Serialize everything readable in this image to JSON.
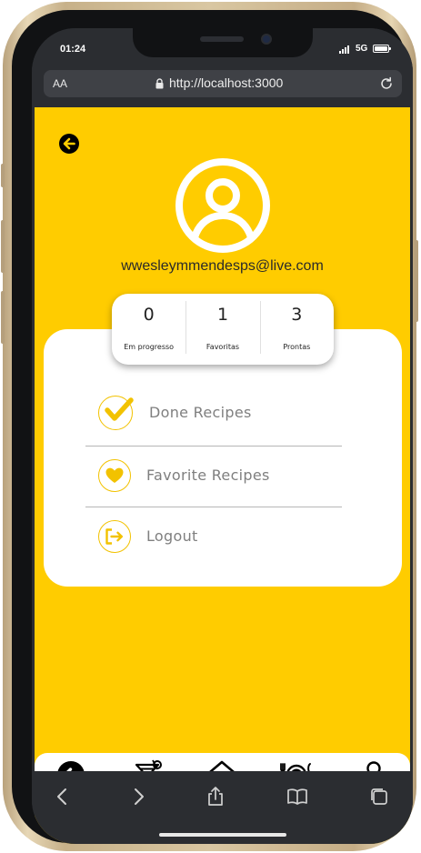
{
  "status_bar": {
    "time": "01:24",
    "network": "5G"
  },
  "browser": {
    "text_size_label": "AA",
    "url": "http://localhost:3000"
  },
  "profile": {
    "email": "wwesleymmendesps@live.com"
  },
  "stats": [
    {
      "value": "0",
      "label": "Em progresso"
    },
    {
      "value": "1",
      "label": "Favoritas"
    },
    {
      "value": "3",
      "label": "Prontas"
    }
  ],
  "menu": {
    "done": "Done Recipes",
    "favorite": "Favorite Recipes",
    "logout": "Logout"
  },
  "colors": {
    "brand_yellow": "#ffcc00",
    "icon_yellow": "#f2c200",
    "menu_text": "#7f7f7f"
  },
  "icons": {
    "back": "arrow-left-circle-icon",
    "avatar": "user-circle-icon",
    "done": "check-icon",
    "favorite": "heart-icon",
    "logout": "logout-icon",
    "nav": [
      "arrow-left-circle-icon",
      "cocktail-icon",
      "home-icon",
      "plate-icon",
      "user-icon"
    ]
  }
}
